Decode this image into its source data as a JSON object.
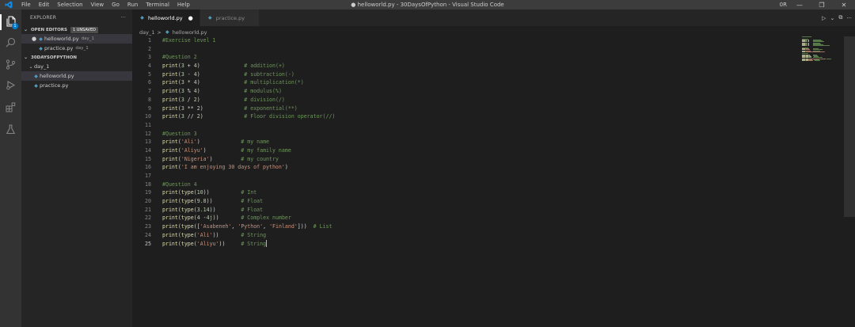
{
  "window": {
    "title": "● helloworld.py - 30DaysOfPython - Visual Studio Code",
    "menu": [
      "File",
      "Edit",
      "Selection",
      "View",
      "Go",
      "Run",
      "Terminal",
      "Help"
    ],
    "layout_label": "0R",
    "controls": {
      "minimize": "—",
      "restore": "❐",
      "close": "✕"
    }
  },
  "activity_bar": {
    "items": [
      "files-icon",
      "search-icon",
      "source-control-icon",
      "run-debug-icon",
      "extensions-icon",
      "testing-icon"
    ],
    "badge": "1"
  },
  "sidebar": {
    "header": "EXPLORER",
    "more": "···",
    "open_editors": {
      "title": "OPEN EDITORS",
      "badge": "1 UNSAVED",
      "items": [
        {
          "name": "helloworld.py",
          "desc": "day_1",
          "modified": "●"
        },
        {
          "name": "practice.py",
          "desc": "day_1",
          "modified": ""
        }
      ]
    },
    "workspace": {
      "title": "30DAYSOFPYTHON",
      "folder": "day_1",
      "files": [
        "helloworld.py",
        "practice.py"
      ]
    }
  },
  "tabs": [
    {
      "label": "helloworld.py",
      "modified": "●"
    },
    {
      "label": "practice.py",
      "modified": ""
    }
  ],
  "breadcrumb": {
    "folder": "day_1",
    "sep": ">",
    "file": "helloworld.py"
  },
  "editor": {
    "file_icon": "◆",
    "actions": {
      "run": "▷",
      "dropdown": "⌄",
      "split": "⧉",
      "more": "···"
    },
    "lines": [
      {
        "n": "1",
        "code": [
          [
            "cm",
            "#Exercise level 1"
          ]
        ]
      },
      {
        "n": "2",
        "code": []
      },
      {
        "n": "3",
        "code": [
          [
            "cm",
            "#Question 2"
          ]
        ]
      },
      {
        "n": "4",
        "code": [
          [
            "fn",
            "print"
          ],
          [
            "p",
            "("
          ],
          [
            "nm",
            "3"
          ],
          [
            "p",
            " + "
          ],
          [
            "nm",
            "4"
          ],
          [
            "p",
            ")              "
          ],
          [
            "cm",
            "# addition(+)"
          ]
        ]
      },
      {
        "n": "5",
        "code": [
          [
            "fn",
            "print"
          ],
          [
            "p",
            "("
          ],
          [
            "nm",
            "3"
          ],
          [
            "p",
            " - "
          ],
          [
            "nm",
            "4"
          ],
          [
            "p",
            ")              "
          ],
          [
            "cm",
            "# subtraction(-)"
          ]
        ]
      },
      {
        "n": "6",
        "code": [
          [
            "fn",
            "print"
          ],
          [
            "p",
            "("
          ],
          [
            "nm",
            "3"
          ],
          [
            "p",
            " * "
          ],
          [
            "nm",
            "4"
          ],
          [
            "p",
            ")              "
          ],
          [
            "cm",
            "# multiplication(*)"
          ]
        ]
      },
      {
        "n": "7",
        "code": [
          [
            "fn",
            "print"
          ],
          [
            "p",
            "("
          ],
          [
            "nm",
            "3"
          ],
          [
            "p",
            " % "
          ],
          [
            "nm",
            "4"
          ],
          [
            "p",
            ")              "
          ],
          [
            "cm",
            "# modulus(%)"
          ]
        ]
      },
      {
        "n": "8",
        "code": [
          [
            "fn",
            "print"
          ],
          [
            "p",
            "("
          ],
          [
            "nm",
            "3"
          ],
          [
            "p",
            " / "
          ],
          [
            "nm",
            "2"
          ],
          [
            "p",
            ")              "
          ],
          [
            "cm",
            "# division(/)"
          ]
        ]
      },
      {
        "n": "9",
        "code": [
          [
            "fn",
            "print"
          ],
          [
            "p",
            "("
          ],
          [
            "nm",
            "3"
          ],
          [
            "p",
            " ** "
          ],
          [
            "nm",
            "2"
          ],
          [
            "p",
            ")             "
          ],
          [
            "cm",
            "# exponential(**)"
          ]
        ]
      },
      {
        "n": "10",
        "code": [
          [
            "fn",
            "print"
          ],
          [
            "p",
            "("
          ],
          [
            "nm",
            "3"
          ],
          [
            "p",
            " // "
          ],
          [
            "nm",
            "2"
          ],
          [
            "p",
            ")             "
          ],
          [
            "cm",
            "# Floor division operator(//)"
          ]
        ]
      },
      {
        "n": "11",
        "code": []
      },
      {
        "n": "12",
        "code": [
          [
            "cm",
            "#Question 3"
          ]
        ]
      },
      {
        "n": "13",
        "code": [
          [
            "fn",
            "print"
          ],
          [
            "p",
            "("
          ],
          [
            "st",
            "'Ali'"
          ],
          [
            "p",
            ")             "
          ],
          [
            "cm",
            "# my name"
          ]
        ]
      },
      {
        "n": "14",
        "code": [
          [
            "fn",
            "print"
          ],
          [
            "p",
            "("
          ],
          [
            "st",
            "'Aliyu'"
          ],
          [
            "p",
            ")           "
          ],
          [
            "cm",
            "# my family name"
          ]
        ]
      },
      {
        "n": "15",
        "code": [
          [
            "fn",
            "print"
          ],
          [
            "p",
            "("
          ],
          [
            "st",
            "'Nigeria'"
          ],
          [
            "p",
            ")         "
          ],
          [
            "cm",
            "# my country"
          ]
        ]
      },
      {
        "n": "16",
        "code": [
          [
            "fn",
            "print"
          ],
          [
            "p",
            "("
          ],
          [
            "st",
            "'I am enjoying 30 days of python'"
          ],
          [
            "p",
            ")"
          ]
        ]
      },
      {
        "n": "17",
        "code": []
      },
      {
        "n": "18",
        "code": [
          [
            "cm",
            "#Question 4"
          ]
        ]
      },
      {
        "n": "19",
        "code": [
          [
            "fn",
            "print"
          ],
          [
            "p",
            "("
          ],
          [
            "fn",
            "type"
          ],
          [
            "p",
            "("
          ],
          [
            "nm",
            "10"
          ],
          [
            "p",
            "))          "
          ],
          [
            "cm",
            "# Int"
          ]
        ]
      },
      {
        "n": "20",
        "code": [
          [
            "fn",
            "print"
          ],
          [
            "p",
            "("
          ],
          [
            "fn",
            "type"
          ],
          [
            "p",
            "("
          ],
          [
            "nm",
            "9.8"
          ],
          [
            "p",
            "))         "
          ],
          [
            "cm",
            "# Float"
          ]
        ]
      },
      {
        "n": "21",
        "code": [
          [
            "fn",
            "print"
          ],
          [
            "p",
            "("
          ],
          [
            "fn",
            "type"
          ],
          [
            "p",
            "("
          ],
          [
            "nm",
            "3.14"
          ],
          [
            "p",
            "))        "
          ],
          [
            "cm",
            "# Float"
          ]
        ]
      },
      {
        "n": "22",
        "code": [
          [
            "fn",
            "print"
          ],
          [
            "p",
            "("
          ],
          [
            "fn",
            "type"
          ],
          [
            "p",
            "("
          ],
          [
            "nm",
            "4"
          ],
          [
            "p",
            " -"
          ],
          [
            "nm",
            "4j"
          ],
          [
            "p",
            "))       "
          ],
          [
            "cm",
            "# Complex number"
          ]
        ]
      },
      {
        "n": "23",
        "code": [
          [
            "fn",
            "print"
          ],
          [
            "p",
            "("
          ],
          [
            "fn",
            "type"
          ],
          [
            "p",
            "(["
          ],
          [
            "st",
            "'Asabeneh'"
          ],
          [
            "p",
            ", "
          ],
          [
            "st",
            "'Python'"
          ],
          [
            "p",
            ", "
          ],
          [
            "st",
            "'Finland'"
          ],
          [
            "p",
            "]))  "
          ],
          [
            "cm",
            "# List"
          ]
        ]
      },
      {
        "n": "24",
        "code": [
          [
            "fn",
            "print"
          ],
          [
            "p",
            "("
          ],
          [
            "fn",
            "type"
          ],
          [
            "p",
            "("
          ],
          [
            "st",
            "'Ali'"
          ],
          [
            "p",
            "))       "
          ],
          [
            "cm",
            "# String"
          ]
        ]
      },
      {
        "n": "25",
        "code": [
          [
            "fn",
            "print"
          ],
          [
            "p",
            "("
          ],
          [
            "fn",
            "type"
          ],
          [
            "p",
            "("
          ],
          [
            "st",
            "'Aliyu'"
          ],
          [
            "p",
            "))     "
          ],
          [
            "cm",
            "# String"
          ]
        ],
        "current": true
      }
    ]
  },
  "colors": {
    "accent": "#007acc",
    "comment": "#6a9955",
    "function": "#dcdcaa",
    "string": "#ce9178",
    "number": "#b5cea8",
    "python_icon": "#519aba"
  }
}
